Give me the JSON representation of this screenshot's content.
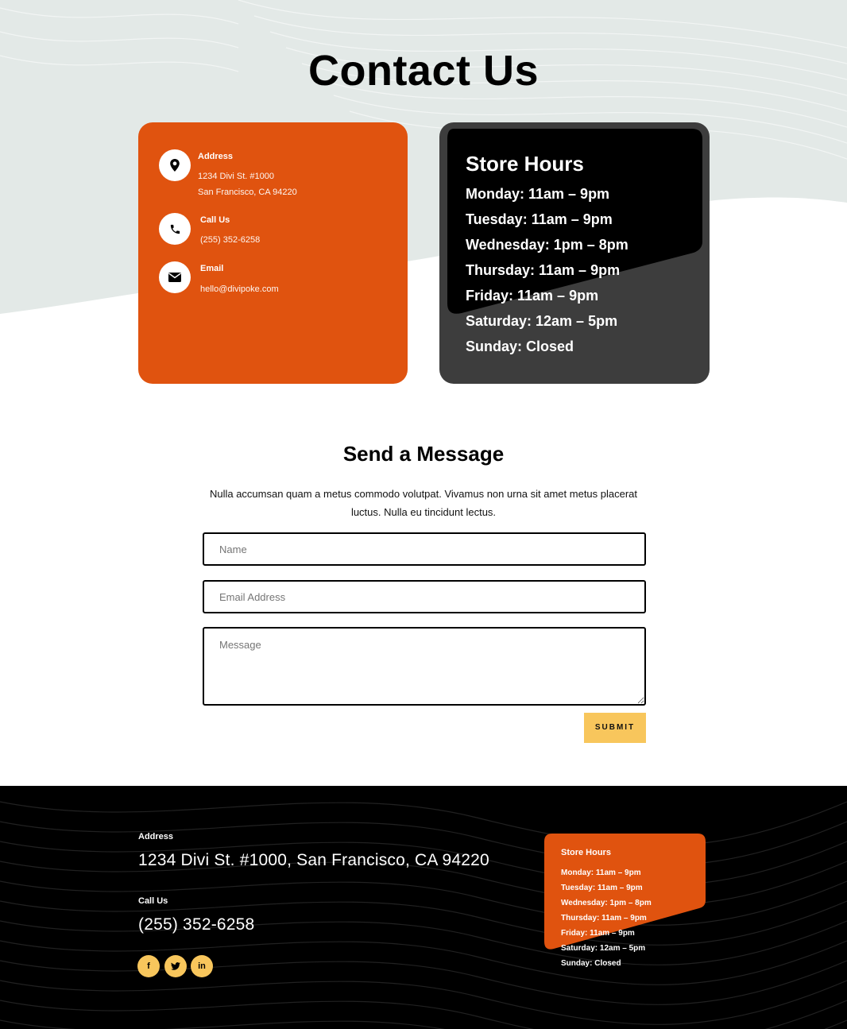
{
  "hero": {
    "title": "Contact Us"
  },
  "contact_card": {
    "address_label": "Address",
    "address_line1": "1234 Divi St. #1000",
    "address_line2": "San Francisco, CA 94220",
    "phone_label": "Call Us",
    "phone": "(255) 352-6258",
    "email_label": "Email",
    "email": "hello@divipoke.com"
  },
  "hours_card": {
    "title": "Store Hours",
    "items": [
      "Monday: 11am – 9pm",
      "Tuesday: 11am – 9pm",
      "Wednesday: 1pm – 8pm",
      "Thursday: 11am – 9pm",
      "Friday: 11am – 9pm",
      "Saturday: 12am – 5pm",
      "Sunday: Closed"
    ]
  },
  "message": {
    "title": "Send a Message",
    "description": "Nulla accumsan quam a metus commodo volutpat. Vivamus non urna sit amet metus placerat luctus. Nulla eu tincidunt lectus.",
    "name_placeholder": "Name",
    "email_placeholder": "Email Address",
    "message_placeholder": "Message",
    "submit_label": "SUBMIT"
  },
  "footer": {
    "address_label": "Address",
    "address": "1234 Divi St. #1000, San Francisco, CA 94220",
    "phone_label": "Call Us",
    "phone": "(255) 352-6258",
    "social": {
      "facebook": "f",
      "twitter": "t",
      "linkedin": "in"
    },
    "hours_title": "Store Hours",
    "hours": [
      "Monday: 11am – 9pm",
      "Tuesday: 11am – 9pm",
      "Wednesday: 1pm – 8pm",
      "Thursday: 11am – 9pm",
      "Friday: 11am – 9pm",
      "Saturday: 12am – 5pm",
      "Sunday: Closed"
    ]
  },
  "colors": {
    "accent_orange": "#e0530f",
    "accent_yellow": "#f8c65c",
    "hero_bg": "#e3e9e7",
    "dark_card": "#3d3d3d"
  },
  "icons": {
    "address": "map-pin-icon",
    "phone": "phone-icon",
    "email": "envelope-icon",
    "facebook": "facebook-icon",
    "twitter": "twitter-icon",
    "linkedin": "linkedin-icon"
  }
}
